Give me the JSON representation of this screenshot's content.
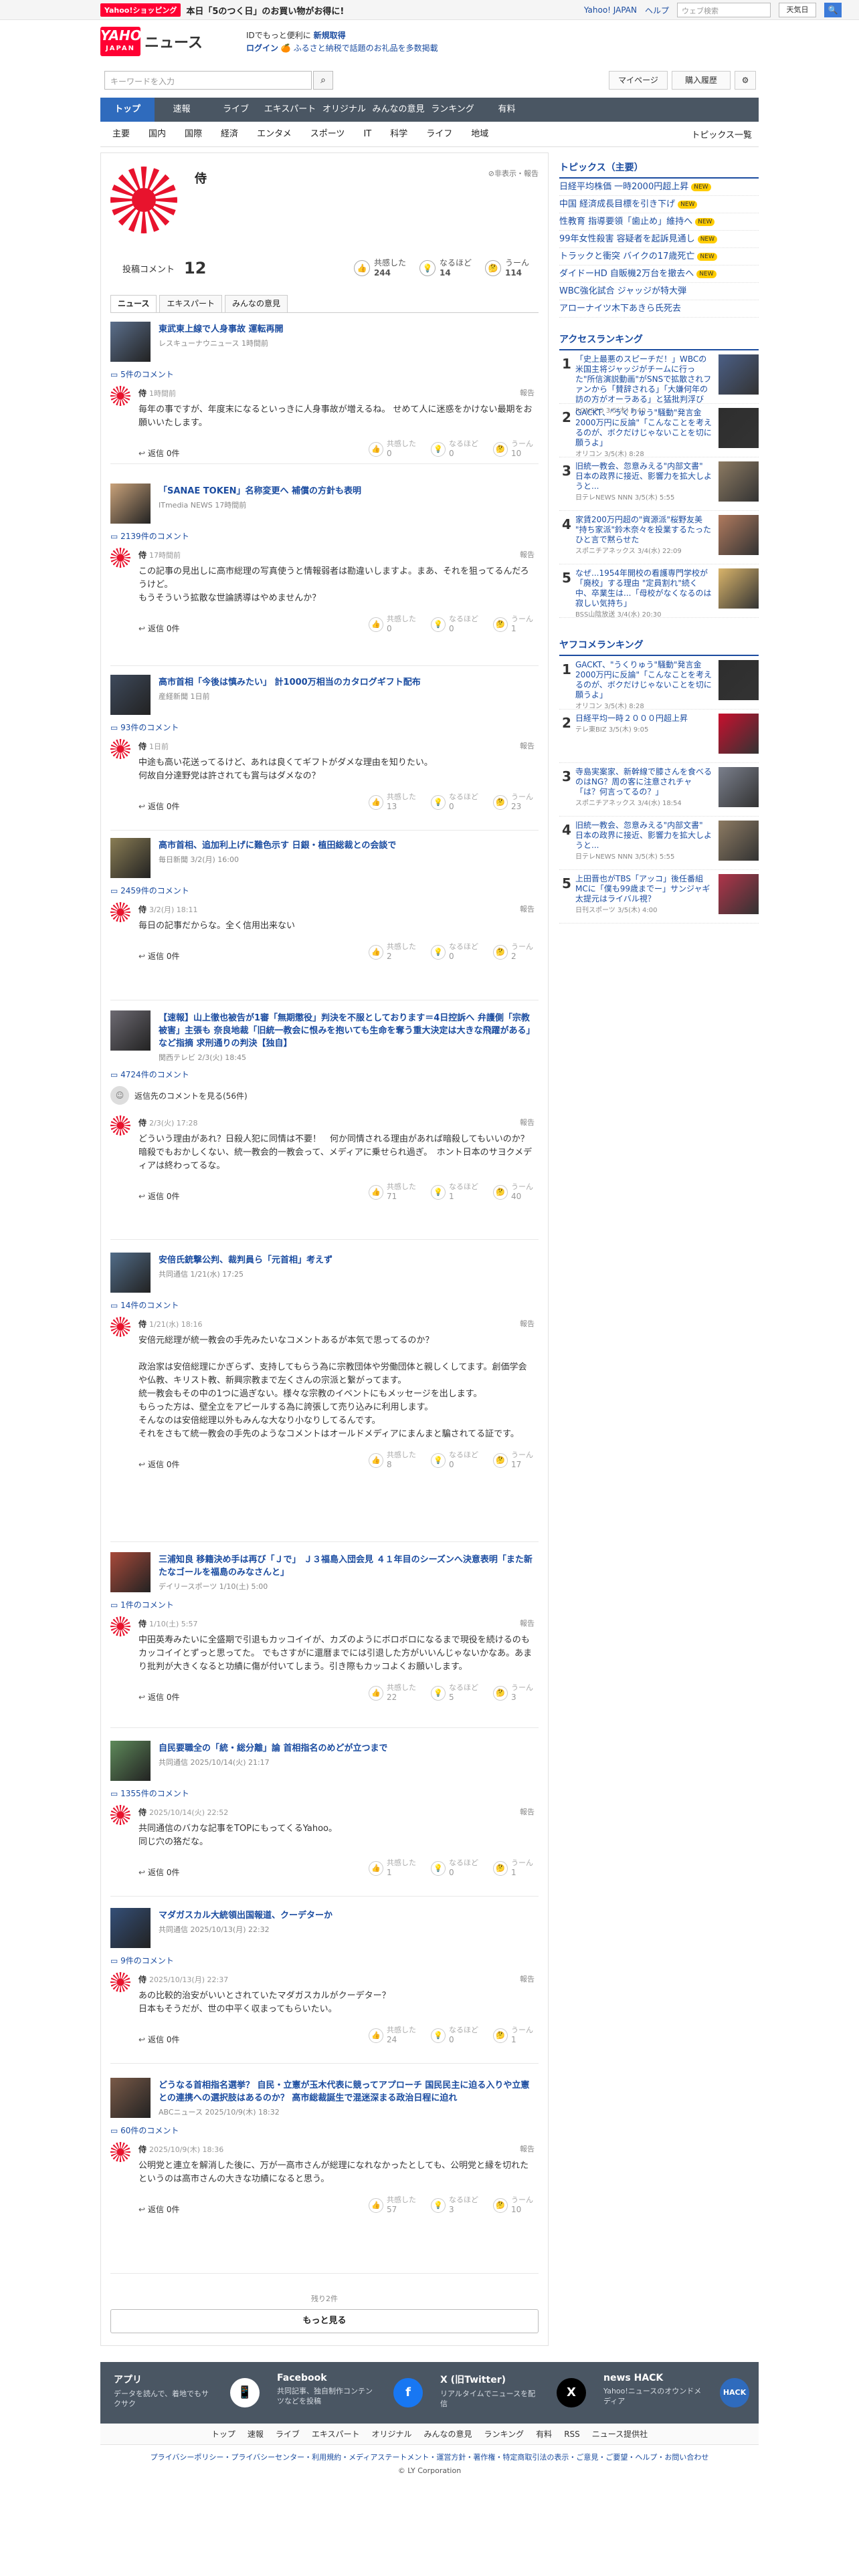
{
  "topbar": {
    "shop_badge": "Yahoo!ショッピング",
    "promo_text": "本日「5のつく日」のお買い物がお得に!",
    "links": [
      "Yahoo! JAPAN",
      "ヘルプ"
    ],
    "search_placeholder": "ウェブ検索",
    "search_btn": "天気日",
    "go": "🔍"
  },
  "header": {
    "logo_top": "YAHOO!",
    "logo_bottom": "JAPAN",
    "logo_news": "ニュース",
    "promo_line1": "IDでもっと便利に",
    "promo_line1_b": "新規取得",
    "promo_line2_a": "ログイン",
    "promo_line2_b": "🍊 ふるさと納税で話題のお礼品を多数掲載"
  },
  "search": {
    "placeholder": "キーワードを入力",
    "mypage": "マイページ",
    "history": "購入履歴",
    "gear": "⚙"
  },
  "nav": {
    "tabs": [
      "トップ",
      "速報",
      "ライブ",
      "エキスパート",
      "オリジナル",
      "みんなの意見",
      "ランキング",
      "有料"
    ]
  },
  "subnav": {
    "items": [
      "主要",
      "国内",
      "国際",
      "経済",
      "エンタメ",
      "スポーツ",
      "IT",
      "科学",
      "ライフ",
      "地域"
    ],
    "right": "トピックス一覧"
  },
  "profile": {
    "name": "侍",
    "links": "⊘非表示・報告"
  },
  "stats": {
    "label": "投稿コメント",
    "count": "12",
    "reacts": [
      {
        "label": "共感した",
        "n": "244"
      },
      {
        "label": "なるほど",
        "n": "14"
      },
      {
        "label": "うーん",
        "n": "114"
      }
    ]
  },
  "tabs": [
    "ニュース",
    "エキスパート",
    "みんなの意見"
  ],
  "entries": [
    {
      "title": "東武東上線で人身事故 運転再開",
      "meta": "レスキューナウニュース 1時間前",
      "count": "5件のコメント",
      "name": "侍",
      "time": "1時間前",
      "report": "報告",
      "body": "毎年の事ですが、年度末になるといっきに人身事故が増えるね。 せめて人に迷惑をかけない最期をお願いいたします。",
      "reply": "返信 0件",
      "r": [
        "0",
        "0",
        "10"
      ]
    },
    {
      "title": "「SANAE TOKEN」名称変更へ 補償の方針も表明",
      "meta": "ITmedia NEWS 17時間前",
      "count": "2139件のコメント",
      "name": "侍",
      "time": "17時間前",
      "report": "報告",
      "body": "この記事の見出しに高市総理の写真使うと情報弱者は勘違いしますよ。まあ、それを狙ってるんだろうけど。\nもうそういう拡散な世論誘導はやめませんか？",
      "reply": "返信 0件",
      "r": [
        "0",
        "0",
        "1"
      ]
    },
    {
      "title": "高市首相「今後は慎みたい」 計1000万相当のカタログギフト配布",
      "meta": "産経新聞 1日前",
      "count": "93件のコメント",
      "name": "侍",
      "time": "1日前",
      "report": "報告",
      "body": "中途も高い花送ってるけど、あれは良くてギフトがダメな理由を知りたい。\n何故自分達野党は許されても賞与はダメなの？",
      "reply": "返信 0件",
      "r": [
        "13",
        "0",
        "23"
      ]
    },
    {
      "title": "高市首相、追加利上げに難色示す 日銀・植田総裁との会談で",
      "meta": "毎日新聞 3/2(月) 16:00",
      "count": "2459件のコメント",
      "name": "侍",
      "time": "3/2(月) 18:11",
      "report": "報告",
      "body": "毎日の記事だからな。全く信用出来ない",
      "reply": "返信 0件",
      "r": [
        "2",
        "0",
        "2"
      ]
    },
    {
      "title": "【速報】山上徹也被告が1審「無期懲役」判決を不服としております＝4日控訴へ 弁護側「宗教被害」主張も 奈良地裁「旧統一教会に恨みを抱いても生命を奪う重大決定は大きな飛躍がある」など指摘 求刑通りの判決【独自】",
      "meta": "関西テレビ 2/3(火) 18:45",
      "count": "4724件のコメント",
      "replies_more": "返信先のコメントを見る(56件)",
      "name": "侍",
      "time": "2/3(火) 17:28",
      "report": "報告",
      "body": "どういう理由があれ？日殺人犯に同情は不要！　何か同情される理由があれば暗殺してもいいのか？\n暗殺でもおかしくない、統一教会的一教会って、メディアに乗せられ過ぎ。　ホント日本のサヨクメディアは終わってるな。",
      "reply": "返信 0件",
      "r": [
        "71",
        "1",
        "40"
      ]
    },
    {
      "title": "安倍氏銃撃公判、裁判員ら「元首相」考えず",
      "meta": "共同通信 1/21(水) 17:25",
      "count": "14件のコメント",
      "name": "侍",
      "time": "1/21(水) 18:16",
      "report": "報告",
      "body": "安倍元総理が統一教会の手先みたいなコメントあるが本気で思ってるのか？\n\n政治家は安倍総理にかぎらず、支持してもらう為に宗教団体や労働団体と親しくしてます。創価学会や仏教、キリスト教、新興宗教まで左くさんの宗派と繋がってます。\n統一教会もその中の1つに過ぎない。様々な宗教のイベントにもメッセージを出します。\nもらった方は、壁全立をアピールする為に誇張して売り込みに利用します。\nそんなのは安倍総理以外もみんな大なり小なりしてるんです。\nそれをさもて統一教会の手先のようなコメントはオールドメディアにまんまと騙されてる証です。",
      "reply": "返信 0件",
      "r": [
        "8",
        "0",
        "17"
      ]
    },
    {
      "title": "三浦知良 移籍決め手は再び「Ｊで」 Ｊ３福島入団会見 ４１年目のシーズンへ決意表明「また新たなゴールを福島のみなさんと」",
      "meta": "デイリースポーツ 1/10(土) 5:00",
      "count": "1件のコメント",
      "name": "侍",
      "time": "1/10(土) 5:57",
      "report": "報告",
      "body": "中田英寿みたいに全盛期で引退もカッコイイが、カズのようにボロボロになるまで現役を続けるのもカッコイイとずっと思ってた。 でもさすがに還暦までには引退した方がいいんじゃないかなあ。あまり批判が大きくなると功績に傷が付いてしまう。引き際もカッコよくお願いします。",
      "reply": "返信 0件",
      "r": [
        "22",
        "5",
        "3"
      ]
    },
    {
      "title": "自民要職全の「統・総分離」論 首相指名のめどが立つまで",
      "meta": "共同通信 2025/10/14(火) 21:17",
      "count": "1355件のコメント",
      "name": "侍",
      "time": "2025/10/14(火) 22:52",
      "report": "報告",
      "body": "共同通信のバカな記事をTOPにもってくるYahoo。\n同じ穴の狢だな。",
      "reply": "返信 0件",
      "r": [
        "1",
        "0",
        "1"
      ]
    },
    {
      "title": "マダガスカル大統領出国報道、クーデターか",
      "meta": "共同通信 2025/10/13(月) 22:32",
      "count": "9件のコメント",
      "name": "侍",
      "time": "2025/10/13(月) 22:37",
      "report": "報告",
      "body": "あの比較的治安がいいとされていたマダガスカルがクーデター？\n日本もそうだが、世の中平く収まってもらいたい。",
      "reply": "返信 0件",
      "r": [
        "24",
        "0",
        "1"
      ]
    },
    {
      "title": "どうなる首相指名選挙？ 自民・立憲が玉木代表に競ってアプローチ 国民民主に迫る入りや立憲との連携への選択肢はあるのか？ 高市総裁誕生で混迷深まる政治日程に迫れ",
      "meta": "ABCニュース 2025/10/9(木) 18:32",
      "count": "60件のコメント",
      "name": "侍",
      "time": "2025/10/9(木) 18:36",
      "report": "報告",
      "body": "公明党と連立を解消した後に、万が一高市さんが総理になれなかったとしても、公明党と縁を切れたというのは高市さんの大きな功績になると思う。",
      "reply": "返信 0件",
      "r": [
        "57",
        "3",
        "10"
      ]
    }
  ],
  "react_labels": [
    "共感した",
    "なるほど",
    "うーん"
  ],
  "more": {
    "remain": "残り2件",
    "button": "もっと見る"
  },
  "sidebar": {
    "topics_title": "トピックス（主要）",
    "topics": [
      "日経平均株価 一時2000円超上昇",
      "中国 経済成長目標を引き下げ",
      "性教育 指導要領「歯止め」維持へ",
      "99年女性殺害 容疑者を起訴見通し",
      "トラックと衝突 バイクの17歳死亡",
      "ダイドーHD 自販機2万台を撤去へ",
      "WBC強化試合 ジャッジが特大弾",
      "アローナイツ木下あきら氏死去"
    ],
    "topic_new": "NEW",
    "access_title": "アクセスランキング",
    "access": [
      {
        "t": "「史上最悪のスピーチだ！」WBCの米国主将ジャッジがチームに行った\"所信演説動画\"がSNSで拡散されファンから「賛辞される」「大嫌何年の訪の方がオーラある」と猛批判浮び",
        "m": "RONSPO 3/5(木) 5:40"
      },
      {
        "t": "GACKT、\"うくりゅう\"騒動\"発言金2000万円に反論\"「こんなことを考えるのが、ボクだけじゃないことを切に願うよ」",
        "m": "オリコン 3/5(木) 8:28"
      },
      {
        "t": "旧統一教会、忽意みえる\"内部文書\" 日本の政界に接近、影響力を拡大しようと...",
        "m": "日テレNEWS NNN 3/5(木) 5:55"
      },
      {
        "t": "家賃200万円超の\"資源派\"桜野友美 \"持ち家派\"鈴木奈々を投業するたったひと言で黙らせた",
        "m": "スポニチアネックス 3/4(水) 22:09"
      },
      {
        "t": "なぜ...1954年開校の看護専門学校が「廃校」する理由 \"定員割れ\"続く中、卒業生は...「母校がなくなるのは寂しい気持ち」",
        "m": "BSS山陰放送 3/4(水) 20:30"
      }
    ],
    "comment_title": "ヤフコメランキング",
    "comment": [
      {
        "t": "GACKT、\"うくりゅう\"騒動\"発言金2000万円に反論\"「こんなことを考えるのが、ボクだけじゃないことを切に願うよ」",
        "m": "オリコン 3/5(木) 8:28"
      },
      {
        "t": "日経平均一時２０００円超上昇",
        "m": "テレ東BIZ 3/5(木) 9:05"
      },
      {
        "t": "寺島実案家、新幹線で膝さんを食べるのはNG？周の客に注意されチャ「は？何言ってるの？」",
        "m": "スポニチアネックス 3/4(水) 18:54"
      },
      {
        "t": "旧統一教会、忽意みえる\"内部文書\" 日本の政界に接近、影響力を拡大しようと...",
        "m": "日テレNEWS NNN 3/5(木) 5:55"
      },
      {
        "t": "上田晋也がTBS「アッコ」後任番組MCに「僕も99歳までー」サンジャギ太提元はライバル視？",
        "m": "日刊スポーツ 3/5(木) 4:00"
      }
    ]
  },
  "footer": {
    "items": [
      {
        "title": "アプリ",
        "desc": "データを読んで、着地でもサクサク"
      },
      {
        "title": "Facebook",
        "desc": "共同記事、独自制作コンテンツなどを投稿"
      },
      {
        "title": "X (旧Twitter)",
        "desc": "リアルタイムでニュースを配信"
      },
      {
        "title": "news HACK",
        "desc": "Yahoo!ニュースのオウンドメディア"
      }
    ],
    "icons": [
      "📱",
      "f",
      "X",
      "HACK"
    ],
    "nav": [
      "トップ",
      "速報",
      "ライブ",
      "エキスパート",
      "オリジナル",
      "みんなの意見",
      "ランキング",
      "有料",
      "RSS",
      "ニュース提供社"
    ]
  },
  "legal": "プライバシーポリシー・プライバシーセンター・利用規約・メディアステートメント・運営方針・著作権・特定商取引法の表示・ご意見・ご要望・ヘルプ・お問い合わせ",
  "copyright": "© LY Corporation",
  "colors": {
    "brand": "#ff0033",
    "link": "#1b4ca0",
    "nav": "#4a5663",
    "active": "#2f6bbd"
  }
}
